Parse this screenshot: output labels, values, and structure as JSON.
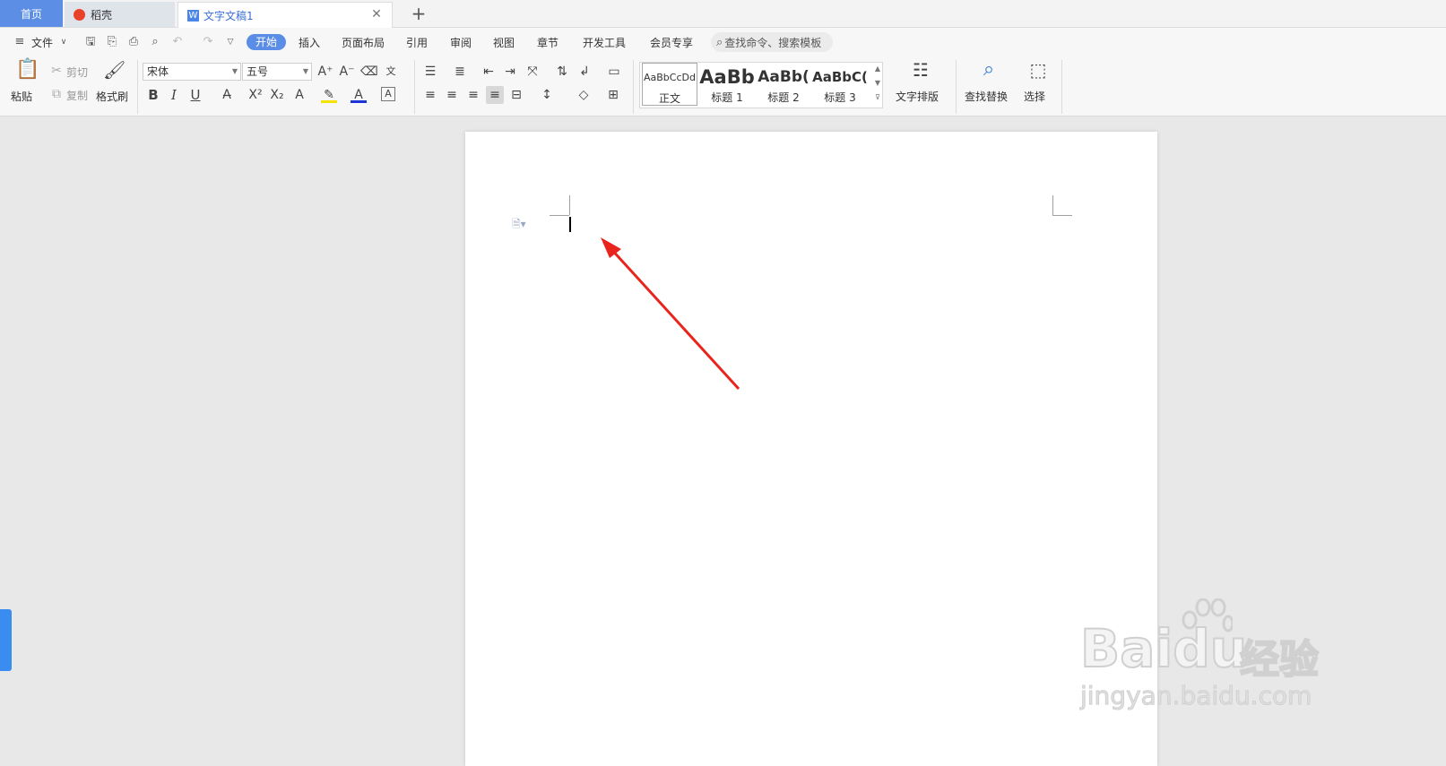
{
  "tabs": {
    "home": "首页",
    "daoke": "稻壳",
    "doc": "文字文稿1",
    "doc_icon": "W"
  },
  "menu": {
    "file": "文件",
    "items": [
      "开始",
      "插入",
      "页面布局",
      "引用",
      "审阅",
      "视图",
      "章节",
      "开发工具",
      "会员专享"
    ],
    "search_placeholder": "查找命令、搜索模板"
  },
  "ribbon": {
    "paste": "粘贴",
    "cut": "剪切",
    "copy": "复制",
    "format_painter": "格式刷",
    "font_name": "宋体",
    "font_size": "五号",
    "bold": "B",
    "italic": "I",
    "underline": "U",
    "styles": [
      {
        "sample": "AaBbCcDd",
        "label": "正文"
      },
      {
        "sample": "AaBb",
        "label": "标题 1"
      },
      {
        "sample": "AaBb(",
        "label": "标题 2"
      },
      {
        "sample": "AaBbC(",
        "label": "标题 3"
      }
    ],
    "text_layout": "文字排版",
    "find_replace": "查找替换",
    "select": "选择"
  },
  "watermark": {
    "brand": "Baidu",
    "brand_cn": "经验",
    "url": "jingyan.baidu.com"
  },
  "colors": {
    "accent": "#5a8de6",
    "arrow": "#e8241d",
    "side_tab": "#3b8cf0"
  }
}
